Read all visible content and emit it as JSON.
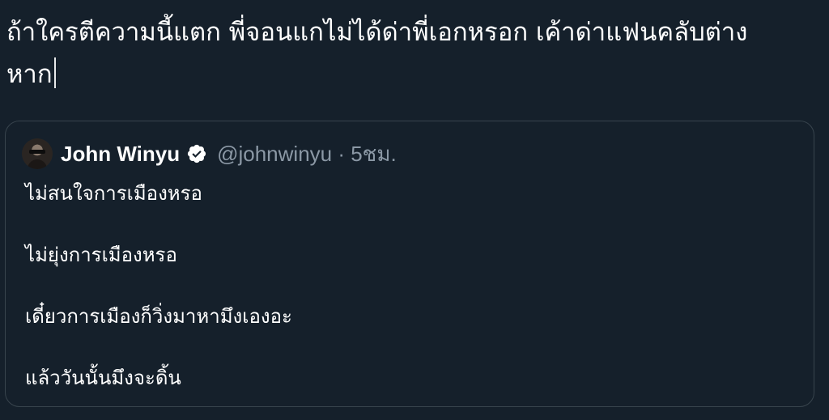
{
  "compose": {
    "line1": "ถ้าใครตีความนี้แตก พี่จอนแกไม่ได้ด่าพี่เอกหรอก เค้าด่าแฟนคลับต่าง",
    "line2": "หาก"
  },
  "quoted_tweet": {
    "author_name": "John Winyu",
    "verified_icon": "verified-badge-icon",
    "handle_time": "@johnwinyu · 5ชม.",
    "lines": [
      "ไม่สนใจการเมืองหรอ",
      "ไม่ยุ่งการเมืองหรอ",
      "เดี๋ยวการเมืองก็วิ่งมาหามึงเองอะ",
      "แล้ววันนั้นมึงจะดิ้น"
    ]
  },
  "colors": {
    "background": "#15202b",
    "border": "#38444d",
    "secondary_text": "#8b98a5",
    "primary_text": "#ffffff"
  }
}
